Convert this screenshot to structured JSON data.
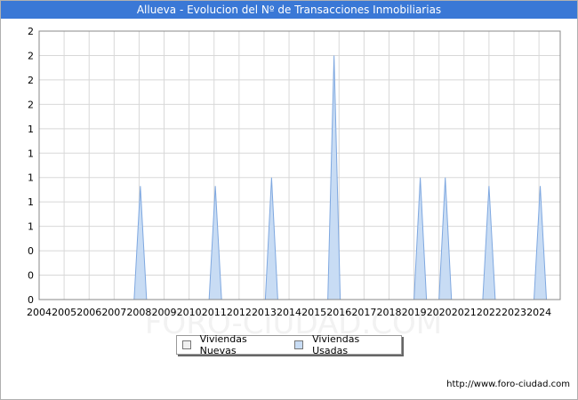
{
  "title": "Allueva - Evolucion del Nº de Transacciones Inmobiliarias",
  "source": "http://www.foro-ciudad.com",
  "watermark": "FORO-CIUDAD.COM",
  "colors": {
    "title_bg": "#3a78d6",
    "nuevas": "#f0f0f0",
    "usadas": "#c8dcf4",
    "usadas_stroke": "#7fa8e0",
    "grid": "#d8d8d8"
  },
  "legend": {
    "nuevas_label": "Viviendas Nuevas",
    "usadas_label": "Viviendas Usadas"
  },
  "chart_data": {
    "type": "area",
    "title": "Allueva - Evolucion del Nº de Transacciones Inmobiliarias",
    "x_ticks": [
      "2004",
      "2005",
      "2006",
      "2007",
      "2008",
      "2009",
      "2010",
      "2011",
      "2012",
      "2013",
      "2014",
      "2015",
      "2016",
      "2017",
      "2018",
      "2019",
      "2020",
      "2021",
      "2022",
      "2023",
      "2024"
    ],
    "y_tick_labels": [
      "0",
      "0",
      "0",
      "1",
      "1",
      "1",
      "1",
      "1",
      "2",
      "2",
      "2",
      "2"
    ],
    "ylim": [
      0,
      2.2
    ],
    "grid": true,
    "legend_position": "bottom-center",
    "series": [
      {
        "name": "Viviendas Nuevas",
        "points": []
      },
      {
        "name": "Viviendas Usadas",
        "points": [
          {
            "x": 2008.05,
            "y": 0.93
          },
          {
            "x": 2011.05,
            "y": 0.93
          },
          {
            "x": 2013.3,
            "y": 1.0
          },
          {
            "x": 2015.8,
            "y": 2.0
          },
          {
            "x": 2019.25,
            "y": 1.0
          },
          {
            "x": 2020.25,
            "y": 1.0
          },
          {
            "x": 2022.0,
            "y": 0.93
          },
          {
            "x": 2024.05,
            "y": 0.93
          }
        ]
      }
    ]
  }
}
